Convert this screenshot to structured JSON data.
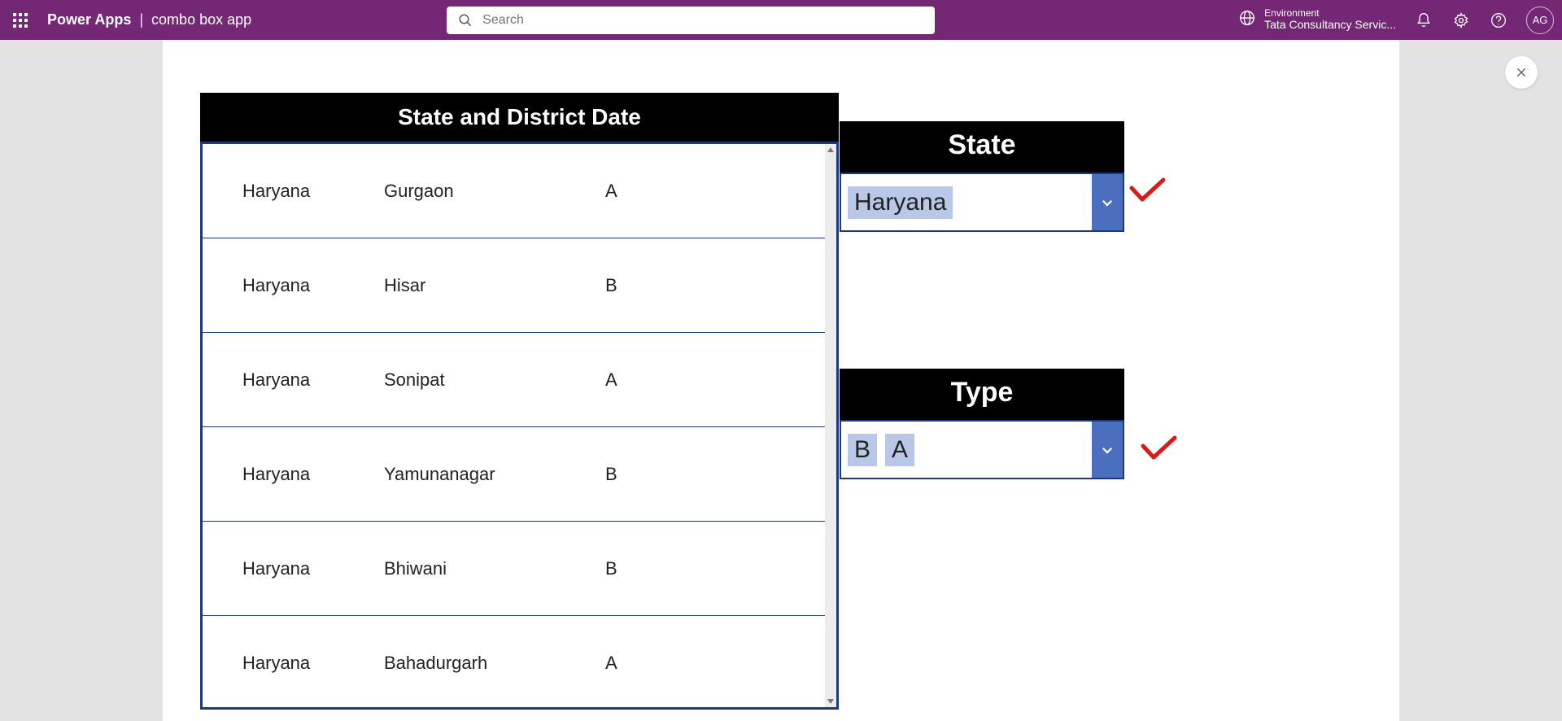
{
  "header": {
    "brand": "Power Apps",
    "divider": "|",
    "app_name": "combo box app",
    "search_placeholder": "Search",
    "env_label": "Environment",
    "env_name": "Tata Consultancy Servic...",
    "avatar_initials": "AG"
  },
  "table": {
    "title": "State and District Date",
    "rows": [
      {
        "state": "Haryana",
        "district": "Gurgaon",
        "type": "A"
      },
      {
        "state": "Haryana",
        "district": "Hisar",
        "type": "B"
      },
      {
        "state": "Haryana",
        "district": "Sonipat",
        "type": "A"
      },
      {
        "state": "Haryana",
        "district": "Yamunanagar",
        "type": "B"
      },
      {
        "state": "Haryana",
        "district": "Bhiwani",
        "type": "B"
      },
      {
        "state": "Haryana",
        "district": "Bahadurgarh",
        "type": "A"
      }
    ]
  },
  "combo_state": {
    "title": "State",
    "values": [
      "Haryana"
    ]
  },
  "combo_type": {
    "title": "Type",
    "values": [
      "B",
      "A"
    ]
  }
}
